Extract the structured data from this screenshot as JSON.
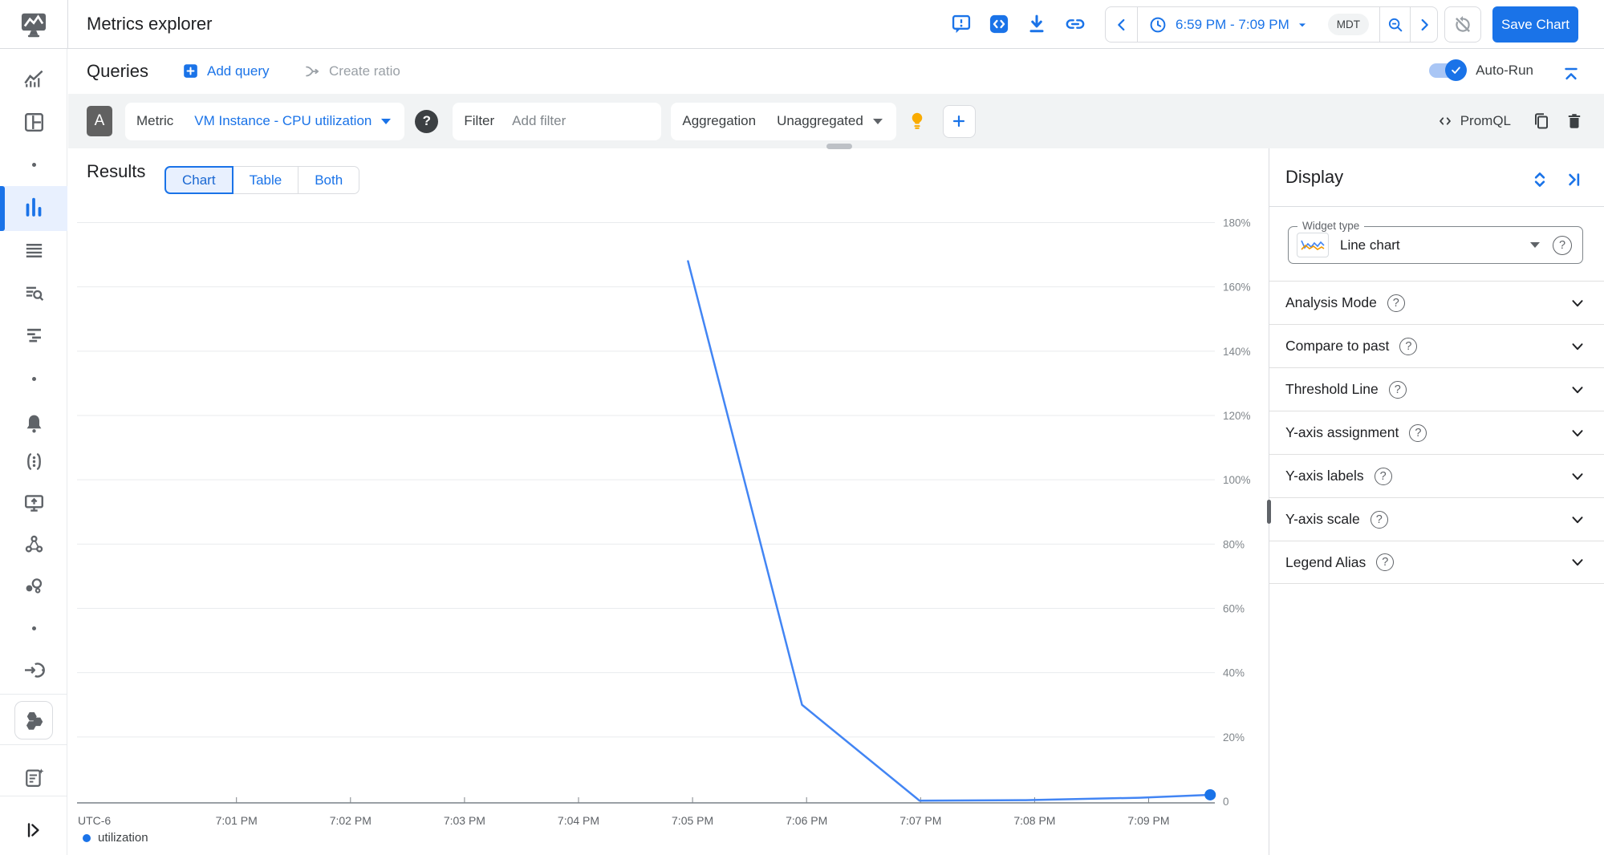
{
  "header": {
    "title": "Metrics explorer",
    "time_range": "6:59 PM - 7:09 PM",
    "timezone": "MDT",
    "save_label": "Save Chart",
    "icons": [
      "feedback-icon",
      "code-icon",
      "download-icon",
      "link-icon",
      "clock-icon",
      "zoom-out-icon",
      "auto-refresh-off-icon"
    ]
  },
  "queries": {
    "title": "Queries",
    "add_query": "Add query",
    "create_ratio": "Create ratio",
    "auto_run": "Auto-Run"
  },
  "builder": {
    "letter": "A",
    "metric_label": "Metric",
    "metric_value": "VM Instance - CPU utilization",
    "filter_label": "Filter",
    "filter_placeholder": "Add filter",
    "aggregation_label": "Aggregation",
    "aggregation_value": "Unaggregated",
    "promql": "PromQL"
  },
  "results": {
    "title": "Results",
    "tabs": [
      {
        "label": "Chart",
        "selected": true
      },
      {
        "label": "Table",
        "selected": false
      },
      {
        "label": "Both",
        "selected": false
      }
    ]
  },
  "display_panel": {
    "title": "Display",
    "widget_type_label": "Widget type",
    "widget_type_value": "Line chart",
    "sections": [
      {
        "label": "Analysis Mode"
      },
      {
        "label": "Compare to past"
      },
      {
        "label": "Threshold Line"
      },
      {
        "label": "Y-axis assignment"
      },
      {
        "label": "Y-axis labels"
      },
      {
        "label": "Y-axis scale"
      },
      {
        "label": "Legend Alias"
      }
    ]
  },
  "icons": {
    "help": "?",
    "sidebar": [
      "overview-chart-icon",
      "dashboards-icon",
      "dot",
      "metrics-explorer-bars-icon",
      "list-icon",
      "logs-search-icon",
      "trace-spans-icon",
      "dot",
      "alerting-bell-icon",
      "uptime-checks-icon",
      "vm-monitor-icon",
      "services-icon",
      "integrations-icon",
      "dot",
      "data-ingest-icon",
      "hexagons-product-icon",
      "release-notes-icon",
      "expand-rail-icon"
    ]
  },
  "colors": {
    "accent": "#1a73e8",
    "line_series": "#4285f4",
    "selected_tab_bg": "#e8f0fe",
    "builder_row_bg": "#f1f3f4",
    "lightbulb": "#f9ab00"
  },
  "chart_data": {
    "type": "line",
    "title": "",
    "xlabel": "",
    "ylabel": "",
    "x_axis": {
      "timezone_label": "UTC-6",
      "ticks": [
        {
          "label": "7:01 PM",
          "minute": 1
        },
        {
          "label": "7:02 PM",
          "minute": 2
        },
        {
          "label": "7:03 PM",
          "minute": 3
        },
        {
          "label": "7:04 PM",
          "minute": 4
        },
        {
          "label": "7:05 PM",
          "minute": 5
        },
        {
          "label": "7:06 PM",
          "minute": 6
        },
        {
          "label": "7:07 PM",
          "minute": 7
        },
        {
          "label": "7:08 PM",
          "minute": 8
        },
        {
          "label": "7:09 PM",
          "minute": 9
        }
      ]
    },
    "y_axis": {
      "unit": "percent",
      "range": [
        0,
        190
      ],
      "ticks": [
        {
          "label": "180%",
          "value": 180
        },
        {
          "label": "160%",
          "value": 160
        },
        {
          "label": "140%",
          "value": 140
        },
        {
          "label": "120%",
          "value": 120
        },
        {
          "label": "100%",
          "value": 100
        },
        {
          "label": "80%",
          "value": 80
        },
        {
          "label": "60%",
          "value": 60
        },
        {
          "label": "40%",
          "value": 40
        },
        {
          "label": "20%",
          "value": 20
        },
        {
          "label": "0",
          "value": 0
        }
      ]
    },
    "series": [
      {
        "name": "utilization",
        "color": "#4285f4",
        "dot_color": "#1a73e8",
        "end_dot": true,
        "points_minutes_percent": [
          [
            4.96,
            168
          ],
          [
            5.96,
            30
          ],
          [
            6.99,
            0.2
          ],
          [
            7.92,
            0.35
          ],
          [
            8.92,
            1.1
          ],
          [
            9.54,
            2.0
          ]
        ]
      }
    ],
    "legend": [
      {
        "label": "utilization",
        "color": "#1a73e8"
      }
    ],
    "grid": true,
    "legend_position": "bottom-left"
  }
}
